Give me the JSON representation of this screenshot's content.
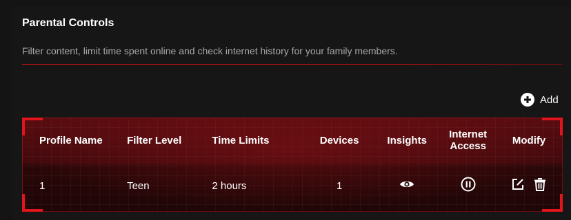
{
  "panel": {
    "title": "Parental Controls",
    "description": "Filter content, limit time spent online and check internet history for your family members."
  },
  "toolbar": {
    "add_label": "Add",
    "add_icon": "plus-circle-icon"
  },
  "table": {
    "headers": {
      "profile_name": "Profile Name",
      "filter_level": "Filter Level",
      "time_limits": "Time Limits",
      "devices": "Devices",
      "insights": "Insights",
      "internet_access_line1": "Internet",
      "internet_access_line2": "Access",
      "modify": "Modify"
    },
    "rows": [
      {
        "profile_name": "1",
        "filter_level": "Teen",
        "time_limits": "2 hours",
        "devices": "1",
        "insights_icon": "eye-icon",
        "internet_access_icon": "pause-icon",
        "modify_icons": [
          "edit-icon",
          "trash-icon"
        ]
      }
    ]
  },
  "colors": {
    "accent": "#e2141c",
    "background": "#141414",
    "text": "#ffffff",
    "muted_text": "#a8a8a8"
  }
}
